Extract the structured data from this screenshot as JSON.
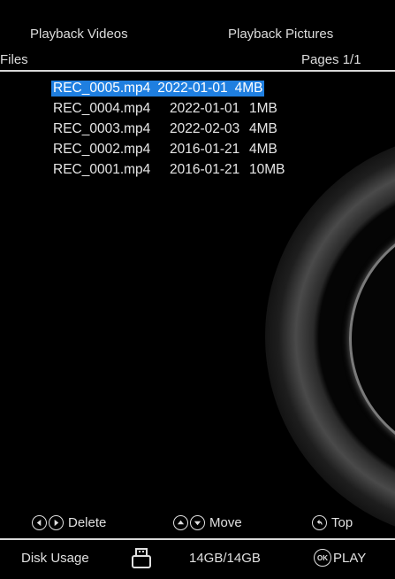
{
  "tabs": {
    "videos": "Playback Videos",
    "pictures": "Playback Pictures"
  },
  "subheader": {
    "files": "Files",
    "pages": "Pages 1/1"
  },
  "files": [
    {
      "name": "REC_0005.mp4",
      "date": "2022-01-01",
      "size": "4MB",
      "selected": true
    },
    {
      "name": "REC_0004.mp4",
      "date": "2022-01-01",
      "size": "1MB",
      "selected": false
    },
    {
      "name": "REC_0003.mp4",
      "date": "2022-02-03",
      "size": "4MB",
      "selected": false
    },
    {
      "name": "REC_0002.mp4",
      "date": "2016-01-21",
      "size": "4MB",
      "selected": false
    },
    {
      "name": "REC_0001.mp4",
      "date": "2016-01-21",
      "size": "10MB",
      "selected": false
    }
  ],
  "hints": {
    "delete": "Delete",
    "move": "Move",
    "top": "Top"
  },
  "status": {
    "disk_usage": "Disk Usage",
    "capacity": "14GB/14GB",
    "ok_icon_text": "OK",
    "play": "PLAY"
  },
  "colors": {
    "background": "#000000",
    "selection": "#1f7fe0",
    "text": "#e6e6e6"
  },
  "icons": [
    "left-circle-icon",
    "right-circle-icon",
    "up-circle-icon",
    "down-circle-icon",
    "back-circle-icon",
    "usb-drive-icon",
    "ok-icon"
  ]
}
